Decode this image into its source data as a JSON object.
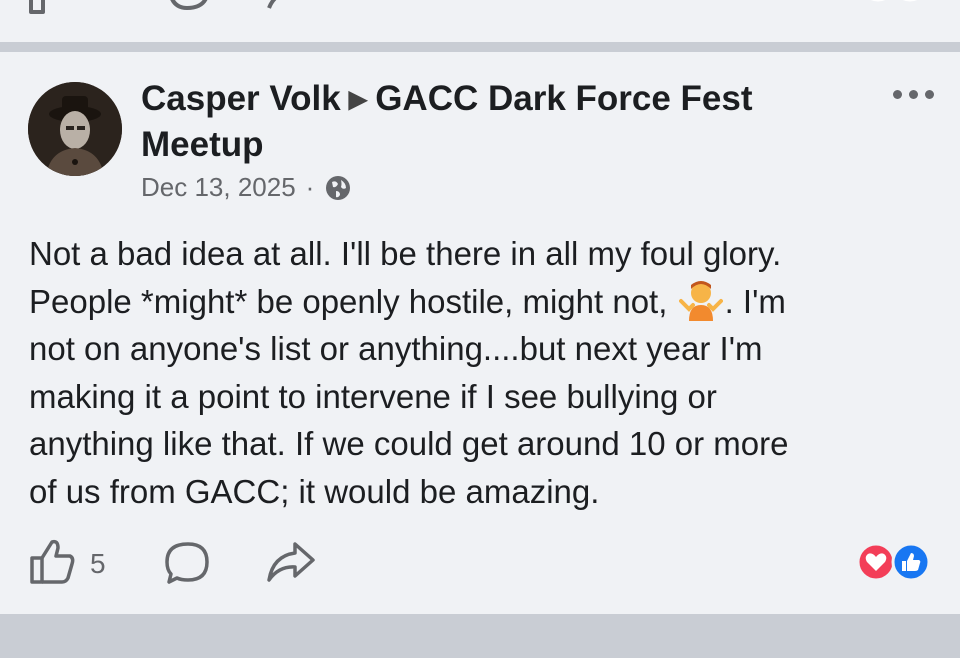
{
  "post": {
    "author": "Casper Volk",
    "group": "GACC Dark Force Fest Meetup",
    "date": "Dec 13, 2025",
    "separator": "·",
    "privacy_icon": "globe-icon",
    "body_lines": [
      "Not a bad idea at all. I'll be there in all my foul glory.",
      "People *might* be openly hostile, might not,",
      ". I'm",
      "not on anyone's list or anything....but next year I'm",
      "making it a point to intervene if I see bullying or",
      "anything like that. If we could get around  10 or more",
      "of us from GACC; it would be amazing."
    ],
    "emoji": "person-shrugging-emoji",
    "like_count": "5",
    "reactions": [
      "love",
      "like"
    ]
  },
  "colors": {
    "background": "#f0f2f5",
    "divider": "#c9cdd4",
    "text": "#1c1e21",
    "muted": "#65676b",
    "like_blue": "#1877f2",
    "love_red": "#f33e58"
  }
}
